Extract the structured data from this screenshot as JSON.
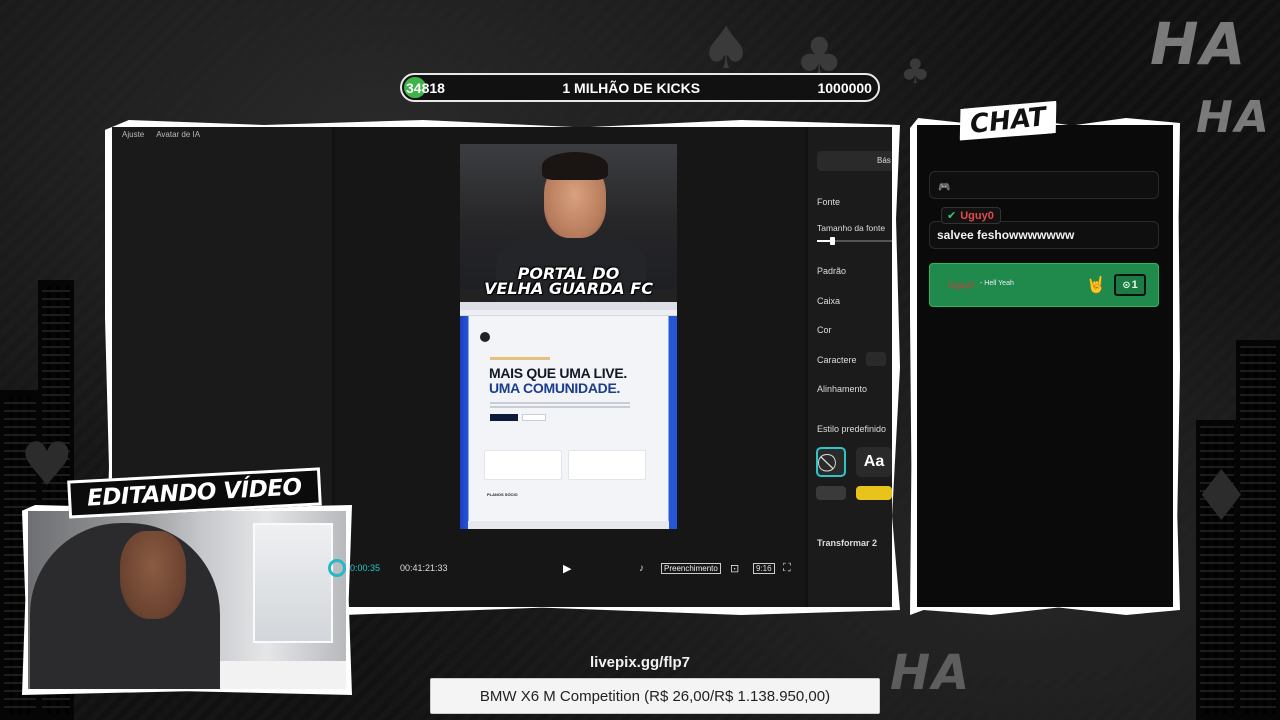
{
  "goal_bar": {
    "current": "34818",
    "title": "1 MILHÃO DE KICKS",
    "target": "1000000",
    "progress_fraction": 0.035,
    "fill_color": "#3db34a"
  },
  "editor": {
    "left_tabs": [
      "Ajuste",
      "Avatar de IA"
    ],
    "video_headline_line1": "PORTAL DO",
    "video_headline_line2": "VELHA GUARDA FC",
    "site_headline_line1": "MAIS QUE UMA LIVE.",
    "site_headline_line2": "UMA COMUNIDADE.",
    "site_section": "PLANOS SÓCIO",
    "transport": {
      "current_time": "00:00:35",
      "total_time": "00:41:21:33",
      "fill_label": "Preenchimento",
      "ratio_label": "9:16",
      "play_icon": "play-icon"
    },
    "right_panel": {
      "tab": "Bás",
      "labels": {
        "font": "Fonte",
        "font_size": "Tamanho da fonte",
        "pattern": "Padrão",
        "case": "Caixa",
        "color": "Cor",
        "character": "Caractere",
        "alignment": "Alinhamento",
        "preset": "Estilo predefinido",
        "transform": "Transformar 2"
      },
      "preset_aa": "Aa",
      "accent_color": "#2cc6c6"
    }
  },
  "chat": {
    "title": "CHAT",
    "badge": "🎮",
    "message": {
      "user": "Uguy0",
      "text": "salvee feshowwwwwww"
    },
    "sub_alert": {
      "user": "Uguy0",
      "text": "- Hell Yeah",
      "emoji": "🤘",
      "count": "1",
      "bg_color": "#1f8a4c"
    }
  },
  "webcam": {
    "label": "EDITANDO VÍDEO"
  },
  "footer": {
    "pix_link": "livepix.gg/flp7",
    "goal_text": "BMW X6 M Competition (R$ 26,00/R$ 1.138.950,00)"
  },
  "decor": {
    "ha_text": "HA"
  }
}
